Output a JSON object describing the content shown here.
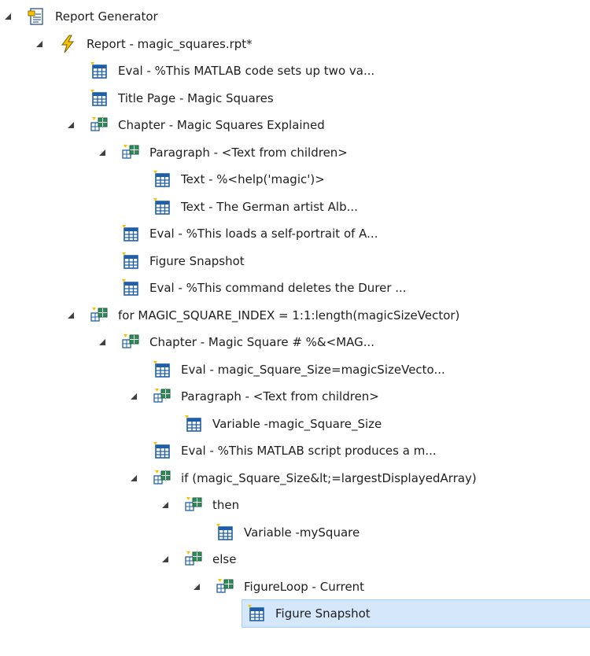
{
  "tree": {
    "nodes": [
      {
        "label": "Report Generator",
        "icon": "report-generator-icon",
        "depth": 0,
        "expandable": true
      },
      {
        "label": "Report - magic_squares.rpt*",
        "icon": "lightning-icon",
        "depth": 1,
        "expandable": true
      },
      {
        "label": "Eval - %This MATLAB code sets up two va...",
        "icon": "table-component-icon",
        "depth": 2,
        "expandable": false
      },
      {
        "label": "Title Page - Magic Squares",
        "icon": "table-component-icon",
        "depth": 2,
        "expandable": false
      },
      {
        "label": "Chapter - Magic Squares Explained",
        "icon": "nested-component-icon",
        "depth": 2,
        "expandable": true
      },
      {
        "label": "Paragraph - <Text from children>",
        "icon": "nested-component-icon",
        "depth": 3,
        "expandable": true
      },
      {
        "label": "Text - %<help('magic')>",
        "icon": "table-component-icon",
        "depth": 4,
        "expandable": false
      },
      {
        "label": "Text - The German artist Alb...",
        "icon": "table-component-icon",
        "depth": 4,
        "expandable": false
      },
      {
        "label": "Eval - %This loads a self-portrait of A...",
        "icon": "table-component-icon",
        "depth": 3,
        "expandable": false
      },
      {
        "label": "Figure Snapshot",
        "icon": "table-component-icon",
        "depth": 3,
        "expandable": false
      },
      {
        "label": "Eval - %This command deletes the Durer ...",
        "icon": "table-component-icon",
        "depth": 3,
        "expandable": false
      },
      {
        "label": "for MAGIC_SQUARE_INDEX = 1:1:length(magicSizeVector)",
        "icon": "nested-component-icon",
        "depth": 2,
        "expandable": true
      },
      {
        "label": "Chapter - Magic Square # %&<MAG...",
        "icon": "nested-component-icon",
        "depth": 3,
        "expandable": true
      },
      {
        "label": "Eval - magic_Square_Size=magicSizeVecto...",
        "icon": "table-component-icon",
        "depth": 4,
        "expandable": false
      },
      {
        "label": "Paragraph - <Text from children>",
        "icon": "nested-component-icon",
        "depth": 4,
        "expandable": true
      },
      {
        "label": "Variable -magic_Square_Size",
        "icon": "table-component-icon",
        "depth": 5,
        "expandable": false
      },
      {
        "label": "Eval - %This MATLAB script produces a m...",
        "icon": "table-component-icon",
        "depth": 4,
        "expandable": false
      },
      {
        "label": "if (magic_Square_Size&lt;=largestDisplayedArray)",
        "icon": "nested-component-icon",
        "depth": 4,
        "expandable": true
      },
      {
        "label": "then",
        "icon": "nested-component-icon",
        "depth": 5,
        "expandable": true
      },
      {
        "label": "Variable -mySquare",
        "icon": "table-component-icon",
        "depth": 6,
        "expandable": false
      },
      {
        "label": "else",
        "icon": "nested-component-icon",
        "depth": 5,
        "expandable": true
      },
      {
        "label": "FigureLoop - Current",
        "icon": "nested-component-icon",
        "depth": 6,
        "expandable": true
      },
      {
        "label": "Figure Snapshot",
        "icon": "table-component-icon",
        "depth": 7,
        "expandable": false,
        "selected": true
      }
    ]
  },
  "colors": {
    "toggle": "#404040",
    "selected_background": "#d5e8fb",
    "icon_blue": "#1f5fa8",
    "icon_green": "#2e8b57",
    "lightning_yellow": "#f5c400"
  }
}
